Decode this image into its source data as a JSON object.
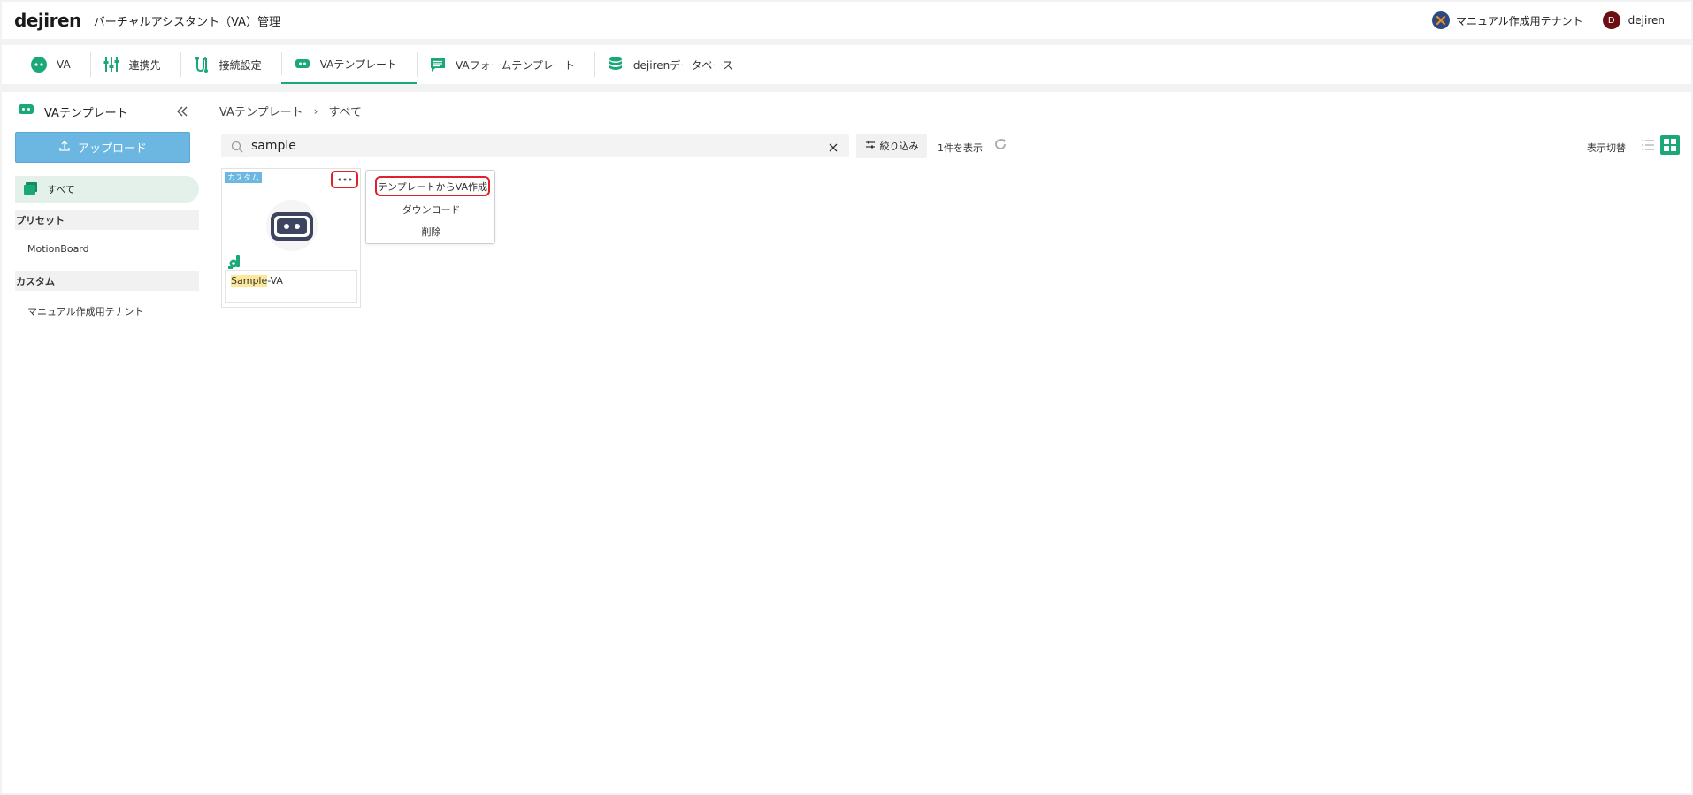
{
  "header": {
    "logo": "dejiren",
    "title": "バーチャルアシスタント（VA）管理",
    "tenant": "マニュアル作成用テナント",
    "user_initial": "D",
    "user_name": "dejiren"
  },
  "tabs": [
    {
      "label": "VA",
      "icon": "robot-face-icon"
    },
    {
      "label": "連携先",
      "icon": "sliders-icon"
    },
    {
      "label": "接続設定",
      "icon": "connection-icon"
    },
    {
      "label": "VAテンプレート",
      "icon": "va-template-icon",
      "active": true
    },
    {
      "label": "VAフォームテンプレート",
      "icon": "form-template-icon"
    },
    {
      "label": "dejirenデータベース",
      "icon": "database-icon"
    }
  ],
  "sidebar": {
    "title": "VAテンプレート",
    "upload_label": "アップロード",
    "all_label": "すべて",
    "sections": [
      {
        "label": "プリセット",
        "items": [
          "MotionBoard"
        ]
      },
      {
        "label": "カスタム",
        "items": [
          "マニュアル作成用テナント"
        ]
      }
    ]
  },
  "breadcrumb": {
    "items": [
      "VAテンプレート",
      "すべて"
    ],
    "separator": "›"
  },
  "toolbar": {
    "search_value": "sample",
    "filter_label": "絞り込み",
    "count_label": "1件を表示",
    "view_toggle_label": "表示切替"
  },
  "card": {
    "badge": "カスタム",
    "name_highlight": "Sample",
    "name_rest": "-VA"
  },
  "dropdown": {
    "items": [
      "テンプレートからVA作成",
      "ダウンロード",
      "削除"
    ]
  },
  "colors": {
    "accent": "#1aa878",
    "upload": "#6bb7e2",
    "highlight_border": "#e0202a"
  }
}
